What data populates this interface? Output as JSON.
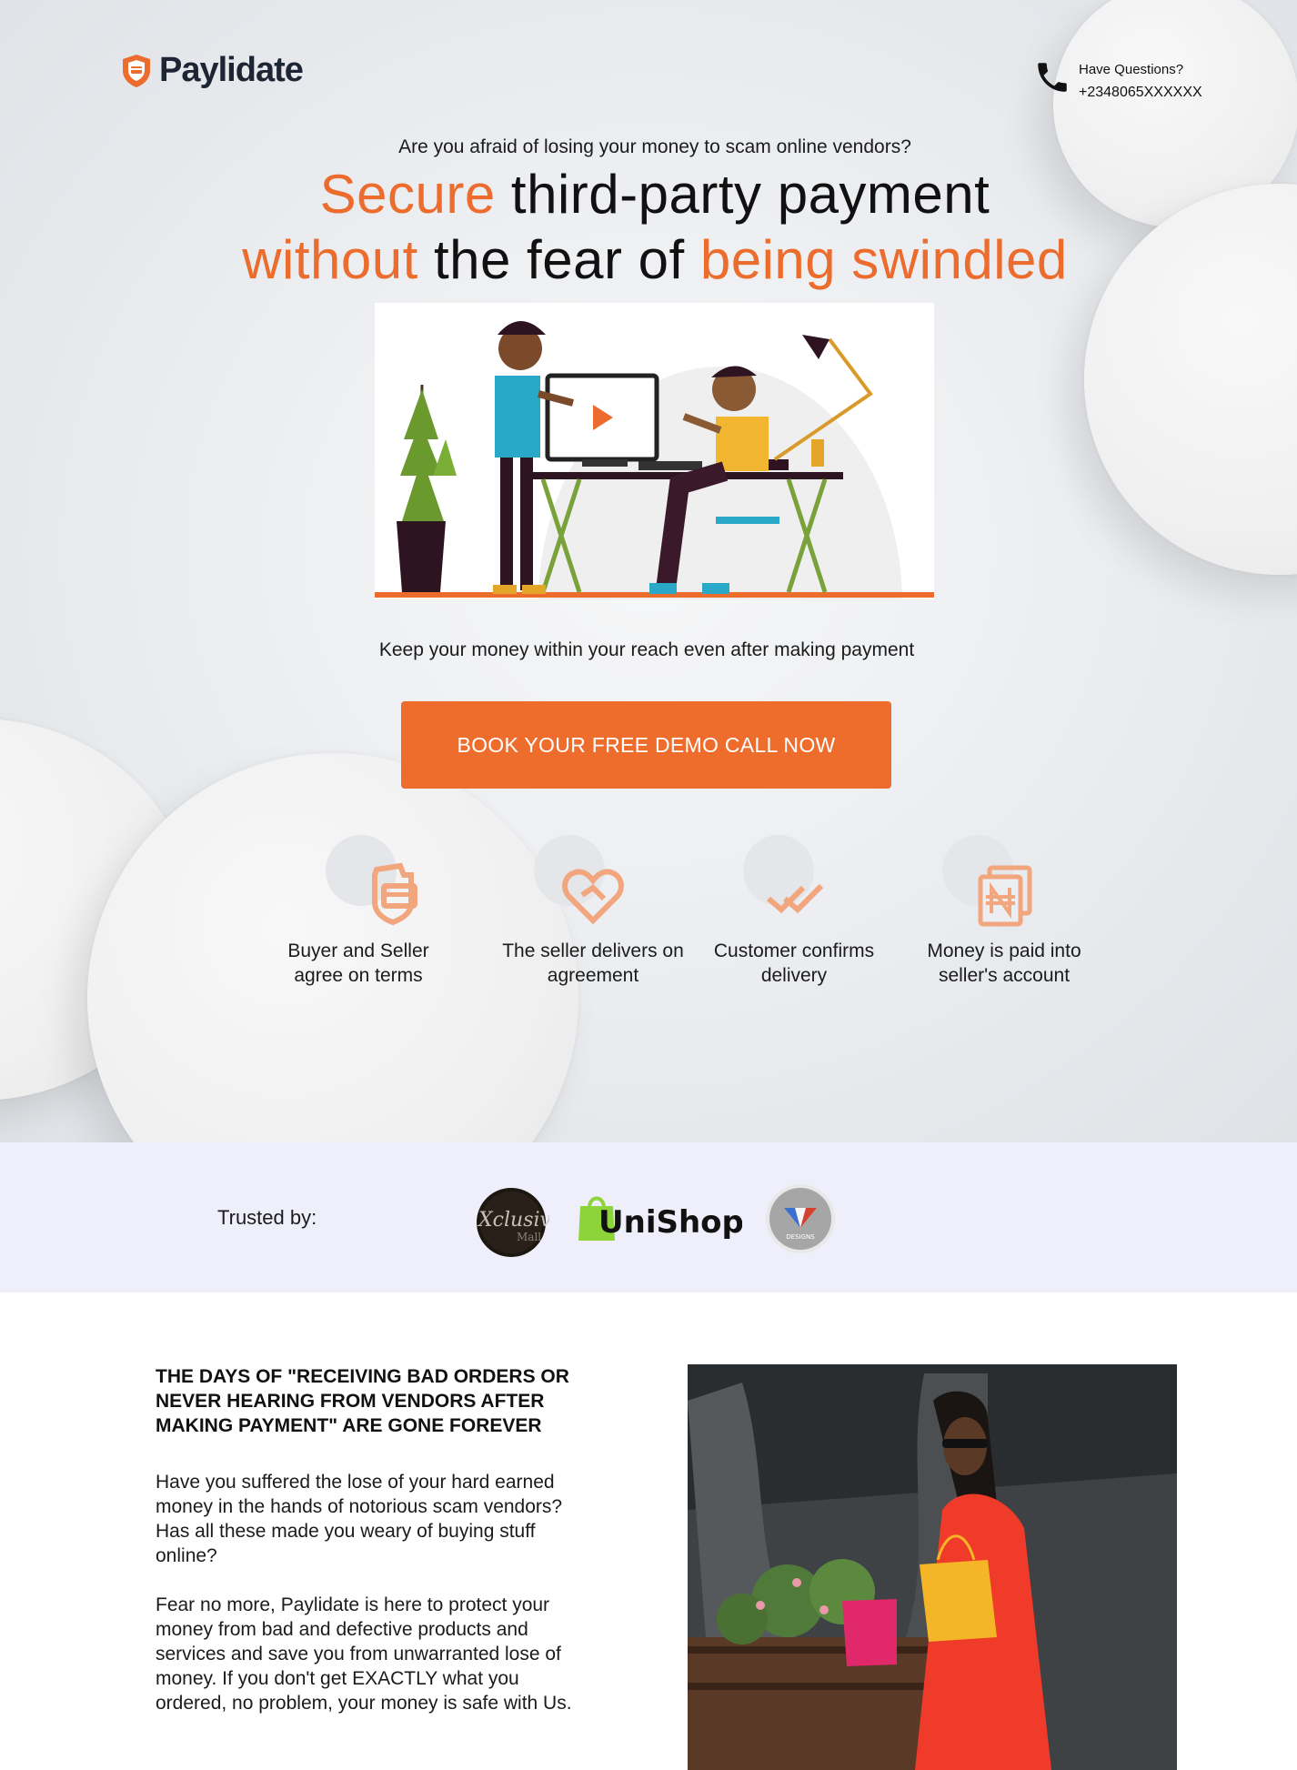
{
  "brand": {
    "name": "Paylidate",
    "accent": "#ec6c2e"
  },
  "contact": {
    "label": "Have Questions?",
    "phone": "+2348065XXXXXX"
  },
  "hero": {
    "question": "Are you afraid of losing your money to scam online vendors?",
    "headline": {
      "line1_orange": "Secure",
      "line1_rest": " third-party payment",
      "line2_orange_a": "without",
      "line2_mid": " the fear of ",
      "line2_orange_b": "being swindled"
    },
    "subline": "Keep your money within your reach even after making payment",
    "cta_label": "BOOK YOUR FREE DEMO CALL NOW"
  },
  "steps": [
    {
      "label": "Buyer and Seller agree on terms",
      "icon": "shield-card-icon"
    },
    {
      "label": "The seller delivers on agreement",
      "icon": "handshake-heart-icon"
    },
    {
      "label": "Customer confirms delivery",
      "icon": "double-check-icon"
    },
    {
      "label": "Money is paid into seller's account",
      "icon": "naira-documents-icon"
    }
  ],
  "trusted": {
    "label": "Trusted by:",
    "logos": [
      {
        "name": "Xclusive Mall",
        "script": "Xclusive",
        "sub": "Mall"
      },
      {
        "name": "UniShop",
        "text": "UniShop"
      },
      {
        "name": "Designs",
        "text": "DESIGNS"
      }
    ]
  },
  "section": {
    "title": "THE DAYS OF \"RECEIVING BAD ORDERS OR NEVER HEARING FROM VENDORS AFTER MAKING PAYMENT\" ARE GONE FOREVER",
    "paragraph1": "Have you suffered the lose of your hard earned money in the hands of notorious scam vendors? Has all these made you weary of buying stuff online?",
    "paragraph2": "Fear no more, Paylidate is here to protect your money from bad and defective products and services and save you from unwarranted lose of money. If you don't get EXACTLY what you ordered, no problem, your money is safe with Us."
  }
}
